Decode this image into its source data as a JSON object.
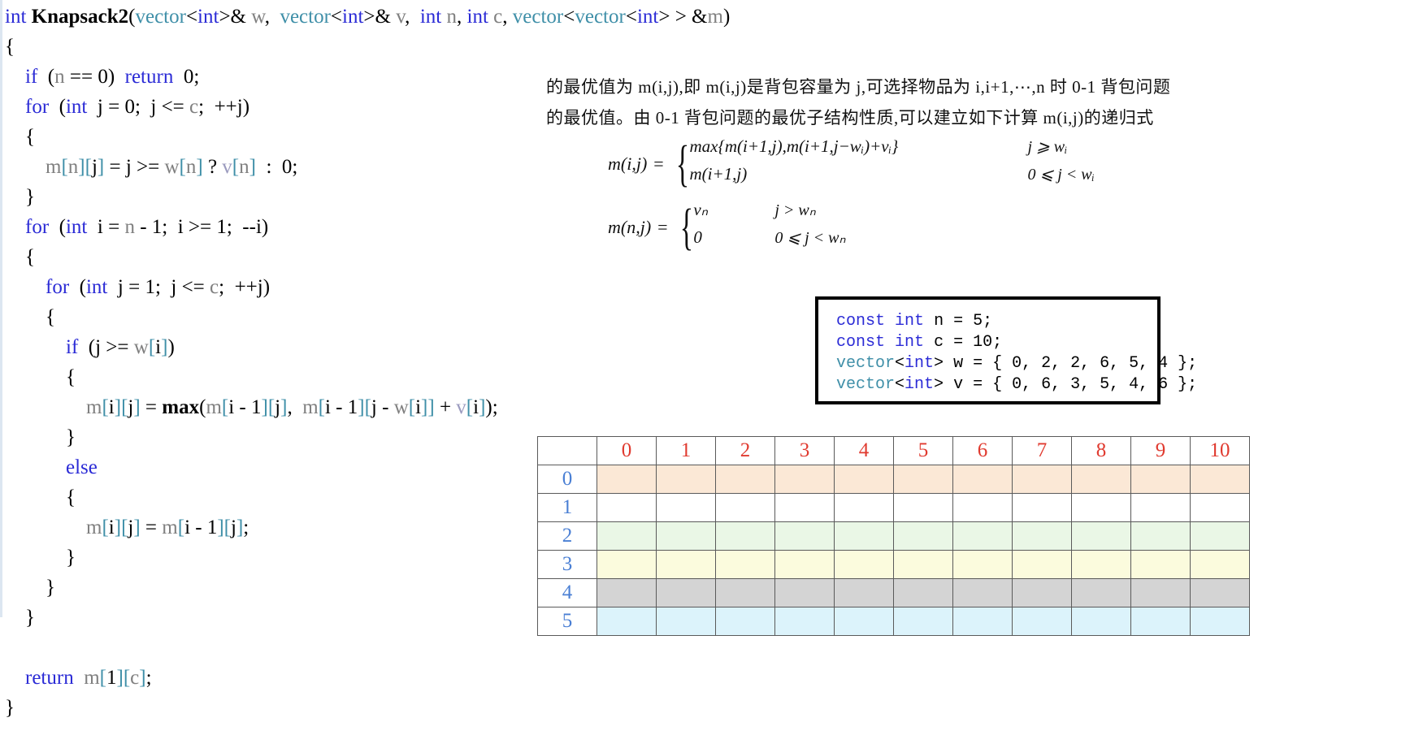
{
  "code": {
    "language": "cpp",
    "lines": [
      [
        {
          "t": "int ",
          "c": "kw"
        },
        {
          "t": "Knapsack2",
          "c": "fn"
        },
        {
          "t": "(",
          "c": "pl"
        },
        {
          "t": "vector",
          "c": "ty"
        },
        {
          "t": "<",
          "c": "pl"
        },
        {
          "t": "int",
          "c": "kw"
        },
        {
          "t": ">& ",
          "c": "pl"
        },
        {
          "t": "w",
          "c": "var"
        },
        {
          "t": ",  ",
          "c": "pl"
        },
        {
          "t": "vector",
          "c": "ty"
        },
        {
          "t": "<",
          "c": "pl"
        },
        {
          "t": "int",
          "c": "kw"
        },
        {
          "t": ">& ",
          "c": "pl"
        },
        {
          "t": "v",
          "c": "var"
        },
        {
          "t": ",  ",
          "c": "pl"
        },
        {
          "t": "int ",
          "c": "kw"
        },
        {
          "t": "n",
          "c": "var"
        },
        {
          "t": ", ",
          "c": "pl"
        },
        {
          "t": "int ",
          "c": "kw"
        },
        {
          "t": "c",
          "c": "var"
        },
        {
          "t": ", ",
          "c": "pl"
        },
        {
          "t": "vector",
          "c": "ty"
        },
        {
          "t": "<",
          "c": "pl"
        },
        {
          "t": "vector",
          "c": "ty"
        },
        {
          "t": "<",
          "c": "pl"
        },
        {
          "t": "int",
          "c": "kw"
        },
        {
          "t": "> > &",
          "c": "pl"
        },
        {
          "t": "m",
          "c": "var"
        },
        {
          "t": ")",
          "c": "pl"
        }
      ],
      [
        {
          "t": "{",
          "c": "pl"
        }
      ],
      [
        {
          "t": "    ",
          "c": "pl"
        },
        {
          "t": "if",
          "c": "kw"
        },
        {
          "t": "  (",
          "c": "pl"
        },
        {
          "t": "n",
          "c": "var"
        },
        {
          "t": " == ",
          "c": "pl"
        },
        {
          "t": "0",
          "c": "num"
        },
        {
          "t": ")  ",
          "c": "pl"
        },
        {
          "t": "return",
          "c": "kw"
        },
        {
          "t": "  ",
          "c": "pl"
        },
        {
          "t": "0",
          "c": "num"
        },
        {
          "t": ";",
          "c": "pl"
        }
      ],
      [
        {
          "t": "    ",
          "c": "pl"
        },
        {
          "t": "for",
          "c": "kw"
        },
        {
          "t": "  (",
          "c": "pl"
        },
        {
          "t": "int",
          "c": "kw"
        },
        {
          "t": "  j = ",
          "c": "pl"
        },
        {
          "t": "0",
          "c": "num"
        },
        {
          "t": ";  j <= ",
          "c": "pl"
        },
        {
          "t": "c",
          "c": "var"
        },
        {
          "t": ";  ++j)",
          "c": "pl"
        }
      ],
      [
        {
          "t": "    {",
          "c": "pl"
        }
      ],
      [
        {
          "t": "        ",
          "c": "pl"
        },
        {
          "t": "m",
          "c": "var"
        },
        {
          "t": "[",
          "c": "br"
        },
        {
          "t": "n",
          "c": "var"
        },
        {
          "t": "]",
          "c": "br"
        },
        {
          "t": "[",
          "c": "br"
        },
        {
          "t": "j",
          "c": "pl"
        },
        {
          "t": "]",
          "c": "br"
        },
        {
          "t": " = j >= ",
          "c": "pl"
        },
        {
          "t": "w",
          "c": "var"
        },
        {
          "t": "[",
          "c": "br"
        },
        {
          "t": "n",
          "c": "var"
        },
        {
          "t": "]",
          "c": "br"
        },
        {
          "t": " ? ",
          "c": "pl"
        },
        {
          "t": "v",
          "c": "vv"
        },
        {
          "t": "[",
          "c": "br"
        },
        {
          "t": "n",
          "c": "var"
        },
        {
          "t": "]",
          "c": "br"
        },
        {
          "t": "  :  ",
          "c": "pl"
        },
        {
          "t": "0",
          "c": "num"
        },
        {
          "t": ";",
          "c": "pl"
        }
      ],
      [
        {
          "t": "    }",
          "c": "pl"
        }
      ],
      [
        {
          "t": "    ",
          "c": "pl"
        },
        {
          "t": "for",
          "c": "kw"
        },
        {
          "t": "  (",
          "c": "pl"
        },
        {
          "t": "int",
          "c": "kw"
        },
        {
          "t": "  i = ",
          "c": "pl"
        },
        {
          "t": "n",
          "c": "var"
        },
        {
          "t": " - ",
          "c": "pl"
        },
        {
          "t": "1",
          "c": "num"
        },
        {
          "t": ";  i >= ",
          "c": "pl"
        },
        {
          "t": "1",
          "c": "num"
        },
        {
          "t": ";  --i)",
          "c": "pl"
        }
      ],
      [
        {
          "t": "    {",
          "c": "pl"
        }
      ],
      [
        {
          "t": "        ",
          "c": "pl"
        },
        {
          "t": "for",
          "c": "kw"
        },
        {
          "t": "  (",
          "c": "pl"
        },
        {
          "t": "int",
          "c": "kw"
        },
        {
          "t": "  j = ",
          "c": "pl"
        },
        {
          "t": "1",
          "c": "num"
        },
        {
          "t": ";  j <= ",
          "c": "pl"
        },
        {
          "t": "c",
          "c": "var"
        },
        {
          "t": ";  ++j)",
          "c": "pl"
        }
      ],
      [
        {
          "t": "        {",
          "c": "pl"
        }
      ],
      [
        {
          "t": "            ",
          "c": "pl"
        },
        {
          "t": "if",
          "c": "kw"
        },
        {
          "t": "  (j >= ",
          "c": "pl"
        },
        {
          "t": "w",
          "c": "var"
        },
        {
          "t": "[",
          "c": "br"
        },
        {
          "t": "i",
          "c": "pl"
        },
        {
          "t": "]",
          "c": "br"
        },
        {
          "t": ")",
          "c": "pl"
        }
      ],
      [
        {
          "t": "            {",
          "c": "pl"
        }
      ],
      [
        {
          "t": "                ",
          "c": "pl"
        },
        {
          "t": "m",
          "c": "var"
        },
        {
          "t": "[",
          "c": "br"
        },
        {
          "t": "i",
          "c": "pl"
        },
        {
          "t": "]",
          "c": "br"
        },
        {
          "t": "[",
          "c": "br"
        },
        {
          "t": "j",
          "c": "pl"
        },
        {
          "t": "]",
          "c": "br"
        },
        {
          "t": " = ",
          "c": "pl"
        },
        {
          "t": "max",
          "c": "fn"
        },
        {
          "t": "(",
          "c": "pl"
        },
        {
          "t": "m",
          "c": "var"
        },
        {
          "t": "[",
          "c": "br"
        },
        {
          "t": "i",
          "c": "pl"
        },
        {
          "t": " - ",
          "c": "pl"
        },
        {
          "t": "1",
          "c": "num"
        },
        {
          "t": "]",
          "c": "br"
        },
        {
          "t": "[",
          "c": "br"
        },
        {
          "t": "j",
          "c": "pl"
        },
        {
          "t": "]",
          "c": "br"
        },
        {
          "t": ",  ",
          "c": "pl"
        },
        {
          "t": "m",
          "c": "var"
        },
        {
          "t": "[",
          "c": "br"
        },
        {
          "t": "i",
          "c": "pl"
        },
        {
          "t": " - ",
          "c": "pl"
        },
        {
          "t": "1",
          "c": "num"
        },
        {
          "t": "]",
          "c": "br"
        },
        {
          "t": "[",
          "c": "br"
        },
        {
          "t": "j",
          "c": "pl"
        },
        {
          "t": " - ",
          "c": "pl"
        },
        {
          "t": "w",
          "c": "var"
        },
        {
          "t": "[",
          "c": "br"
        },
        {
          "t": "i",
          "c": "pl"
        },
        {
          "t": "]",
          "c": "br"
        },
        {
          "t": "]",
          "c": "br"
        },
        {
          "t": " + ",
          "c": "pl"
        },
        {
          "t": "v",
          "c": "vv"
        },
        {
          "t": "[",
          "c": "br"
        },
        {
          "t": "i",
          "c": "pl"
        },
        {
          "t": "]",
          "c": "br"
        },
        {
          "t": ");",
          "c": "pl"
        }
      ],
      [
        {
          "t": "            }",
          "c": "pl"
        }
      ],
      [
        {
          "t": "            ",
          "c": "pl"
        },
        {
          "t": "else",
          "c": "kw"
        }
      ],
      [
        {
          "t": "            {",
          "c": "pl"
        }
      ],
      [
        {
          "t": "                ",
          "c": "pl"
        },
        {
          "t": "m",
          "c": "var"
        },
        {
          "t": "[",
          "c": "br"
        },
        {
          "t": "i",
          "c": "pl"
        },
        {
          "t": "]",
          "c": "br"
        },
        {
          "t": "[",
          "c": "br"
        },
        {
          "t": "j",
          "c": "pl"
        },
        {
          "t": "]",
          "c": "br"
        },
        {
          "t": " = ",
          "c": "pl"
        },
        {
          "t": "m",
          "c": "var"
        },
        {
          "t": "[",
          "c": "br"
        },
        {
          "t": "i",
          "c": "pl"
        },
        {
          "t": " - ",
          "c": "pl"
        },
        {
          "t": "1",
          "c": "num"
        },
        {
          "t": "]",
          "c": "br"
        },
        {
          "t": "[",
          "c": "br"
        },
        {
          "t": "j",
          "c": "pl"
        },
        {
          "t": "]",
          "c": "br"
        },
        {
          "t": ";",
          "c": "pl"
        }
      ],
      [
        {
          "t": "            }",
          "c": "pl"
        }
      ],
      [
        {
          "t": "        }",
          "c": "pl"
        }
      ],
      [
        {
          "t": "    }",
          "c": "pl"
        }
      ],
      [
        {
          "t": "",
          "c": "pl"
        }
      ],
      [
        {
          "t": "    ",
          "c": "pl"
        },
        {
          "t": "return",
          "c": "kw"
        },
        {
          "t": "  ",
          "c": "pl"
        },
        {
          "t": "m",
          "c": "var"
        },
        {
          "t": "[",
          "c": "br"
        },
        {
          "t": "1",
          "c": "num"
        },
        {
          "t": "]",
          "c": "br"
        },
        {
          "t": "[",
          "c": "br"
        },
        {
          "t": "c",
          "c": "var"
        },
        {
          "t": "]",
          "c": "br"
        },
        {
          "t": ";",
          "c": "pl"
        }
      ],
      [
        {
          "t": "}",
          "c": "pl"
        }
      ]
    ]
  },
  "prose": {
    "line1": "的最优值为 m(i,j),即 m(i,j)是背包容量为 j,可选择物品为 i,i+1,⋯,n 时 0-1 背包问题",
    "line2": "的最优值。由 0-1 背包问题的最优子结构性质,可以建立如下计算 m(i,j)的递归式"
  },
  "formulas": [
    {
      "lhs": "m(i,j)",
      "eq": "=",
      "cases": [
        {
          "body": "max{m(i+1,j),m(i+1,j−wᵢ)+vᵢ}",
          "cond": "j ⩾ wᵢ"
        },
        {
          "body": "m(i+1,j)",
          "cond": "0 ⩽ j < wᵢ"
        }
      ]
    },
    {
      "lhs": "m(n,j)",
      "eq": "=",
      "cases": [
        {
          "body": "vₙ",
          "cond": "j > wₙ"
        },
        {
          "body": "0",
          "cond": "0 ⩽ j < wₙ"
        }
      ]
    }
  ],
  "const_box": {
    "lines": [
      [
        {
          "t": "const",
          "c": "kw"
        },
        {
          "t": " ",
          "c": "pl"
        },
        {
          "t": "int",
          "c": "kw"
        },
        {
          "t": " ",
          "c": "pl"
        },
        {
          "t": "n",
          "c": "pl"
        },
        {
          "t": " = ",
          "c": "pl"
        },
        {
          "t": "5",
          "c": "num"
        },
        {
          "t": ";",
          "c": "pl"
        }
      ],
      [
        {
          "t": "const",
          "c": "kw"
        },
        {
          "t": " ",
          "c": "pl"
        },
        {
          "t": "int",
          "c": "kw"
        },
        {
          "t": " ",
          "c": "pl"
        },
        {
          "t": "c",
          "c": "pl"
        },
        {
          "t": " = ",
          "c": "pl"
        },
        {
          "t": "10",
          "c": "num"
        },
        {
          "t": ";",
          "c": "pl"
        }
      ],
      [
        {
          "t": "vector",
          "c": "ty"
        },
        {
          "t": "<",
          "c": "pl"
        },
        {
          "t": "int",
          "c": "kw"
        },
        {
          "t": "> ",
          "c": "pl"
        },
        {
          "t": "w",
          "c": "pl"
        },
        {
          "t": " = { ",
          "c": "pl"
        },
        {
          "t": "0, 2, 2, 6, 5, 4",
          "c": "num"
        },
        {
          "t": " };",
          "c": "pl"
        }
      ],
      [
        {
          "t": "vector",
          "c": "ty"
        },
        {
          "t": "<",
          "c": "pl"
        },
        {
          "t": "int",
          "c": "kw"
        },
        {
          "t": "> ",
          "c": "pl"
        },
        {
          "t": "v",
          "c": "pl"
        },
        {
          "t": " = { ",
          "c": "pl"
        },
        {
          "t": "0, 6, 3, 5, 4, 6",
          "c": "num"
        },
        {
          "t": " };",
          "c": "pl"
        }
      ]
    ],
    "plain": [
      "const int n = 5;",
      "const int c = 10;",
      "vector<int> w = { 0, 2, 2, 6, 5, 4 };",
      "vector<int> v = { 0, 6, 3, 5, 4, 6 };"
    ]
  },
  "dp_table": {
    "corner": "",
    "col_headers": [
      "0",
      "1",
      "2",
      "3",
      "4",
      "5",
      "6",
      "7",
      "8",
      "9",
      "10"
    ],
    "row_headers": [
      "0",
      "1",
      "2",
      "3",
      "4",
      "5"
    ],
    "row_colors": [
      "#fbe8d6",
      "#ffffff",
      "#eaf7e6",
      "#fbfbdd",
      "#d4d4d4",
      "#dcf3fb"
    ],
    "header_color": "#e03a2f",
    "rowhdr_color": "#4a7fd4",
    "cells": [
      [
        "",
        "",
        "",
        "",
        "",
        "",
        "",
        "",
        "",
        "",
        ""
      ],
      [
        "",
        "",
        "",
        "",
        "",
        "",
        "",
        "",
        "",
        "",
        ""
      ],
      [
        "",
        "",
        "",
        "",
        "",
        "",
        "",
        "",
        "",
        "",
        ""
      ],
      [
        "",
        "",
        "",
        "",
        "",
        "",
        "",
        "",
        "",
        "",
        ""
      ],
      [
        "",
        "",
        "",
        "",
        "",
        "",
        "",
        "",
        "",
        "",
        ""
      ],
      [
        "",
        "",
        "",
        "",
        "",
        "",
        "",
        "",
        "",
        "",
        ""
      ]
    ]
  }
}
